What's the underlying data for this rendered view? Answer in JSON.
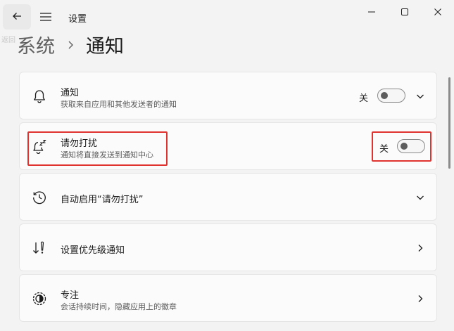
{
  "window": {
    "title": "设置",
    "ghost_label": "返回",
    "icons": {
      "back": "arrow-left-icon",
      "menu": "hamburger-icon",
      "minimize": "minimize-icon",
      "maximize": "maximize-icon",
      "close": "close-icon"
    }
  },
  "breadcrumb": {
    "parent": "系统",
    "current": "通知"
  },
  "cards": [
    {
      "id": "notifications",
      "icon": "bell-icon",
      "title": "通知",
      "subtitle": "获取来自应用和其他发送者的通知",
      "toggle_label": "关",
      "toggle_on": false,
      "chevron": "chevron-down-icon"
    },
    {
      "id": "do-not-disturb",
      "icon": "bell-zzz-icon",
      "title": "请勿打扰",
      "subtitle": "通知将直接发送到通知中心",
      "toggle_label": "关",
      "toggle_on": false
    },
    {
      "id": "auto-dnd",
      "icon": "clock-icon",
      "title": "自动启用“请勿打扰”",
      "chevron": "chevron-down-icon"
    },
    {
      "id": "priority",
      "icon": "priority-icon",
      "title": "设置优先级通知",
      "chevron": "chevron-right-icon"
    },
    {
      "id": "focus",
      "icon": "focus-icon",
      "title": "专注",
      "subtitle": "会话持续时间，隐藏应用上的徽章",
      "chevron": "chevron-right-icon"
    }
  ],
  "colors": {
    "background": "#f3f3f3",
    "card": "#fbfbfb",
    "highlight": "#e0332f"
  }
}
